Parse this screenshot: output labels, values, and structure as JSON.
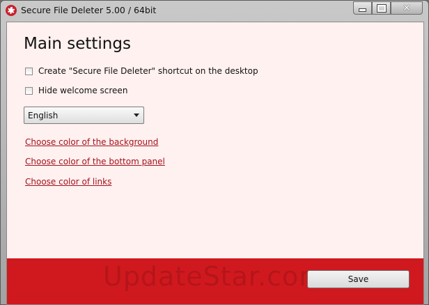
{
  "window": {
    "title": "Secure File Deleter 5.00 / 64bit"
  },
  "main": {
    "heading": "Main settings",
    "options": [
      {
        "label": "Create \"Secure File Deleter\" shortcut on the desktop",
        "checked": false
      },
      {
        "label": "Hide welcome screen",
        "checked": false
      }
    ],
    "language": {
      "selected": "English"
    },
    "links": [
      "Choose color of the background",
      "Choose color of the bottom panel",
      "Choose color of links"
    ]
  },
  "bottom": {
    "watermark": "UpdateStar.com",
    "save_label": "Save",
    "panel_color": "#d0191e"
  },
  "colors": {
    "link": "#a3121c",
    "background": "#fff1f0"
  }
}
